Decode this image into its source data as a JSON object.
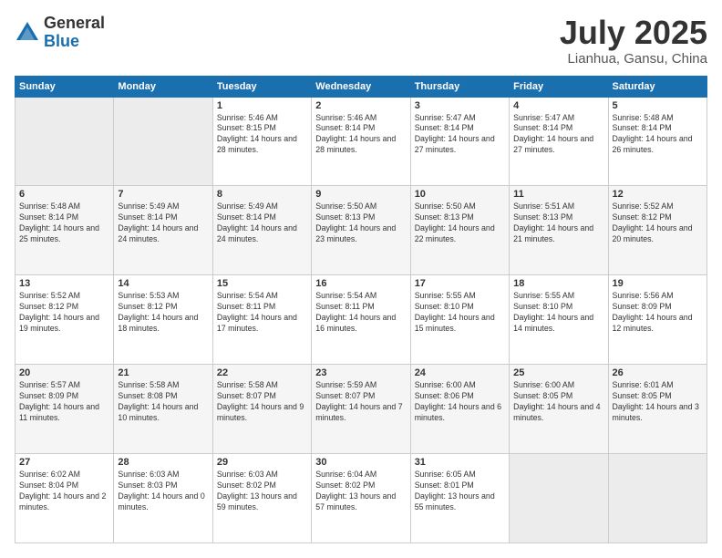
{
  "logo": {
    "general": "General",
    "blue": "Blue"
  },
  "header": {
    "month": "July 2025",
    "location": "Lianhua, Gansu, China"
  },
  "weekdays": [
    "Sunday",
    "Monday",
    "Tuesday",
    "Wednesday",
    "Thursday",
    "Friday",
    "Saturday"
  ],
  "weeks": [
    [
      {
        "day": "",
        "empty": true
      },
      {
        "day": "",
        "empty": true
      },
      {
        "day": "1",
        "sunrise": "5:46 AM",
        "sunset": "8:15 PM",
        "daylight": "14 hours and 28 minutes."
      },
      {
        "day": "2",
        "sunrise": "5:46 AM",
        "sunset": "8:14 PM",
        "daylight": "14 hours and 28 minutes."
      },
      {
        "day": "3",
        "sunrise": "5:47 AM",
        "sunset": "8:14 PM",
        "daylight": "14 hours and 27 minutes."
      },
      {
        "day": "4",
        "sunrise": "5:47 AM",
        "sunset": "8:14 PM",
        "daylight": "14 hours and 27 minutes."
      },
      {
        "day": "5",
        "sunrise": "5:48 AM",
        "sunset": "8:14 PM",
        "daylight": "14 hours and 26 minutes."
      }
    ],
    [
      {
        "day": "6",
        "sunrise": "5:48 AM",
        "sunset": "8:14 PM",
        "daylight": "14 hours and 25 minutes."
      },
      {
        "day": "7",
        "sunrise": "5:49 AM",
        "sunset": "8:14 PM",
        "daylight": "14 hours and 24 minutes."
      },
      {
        "day": "8",
        "sunrise": "5:49 AM",
        "sunset": "8:14 PM",
        "daylight": "14 hours and 24 minutes."
      },
      {
        "day": "9",
        "sunrise": "5:50 AM",
        "sunset": "8:13 PM",
        "daylight": "14 hours and 23 minutes."
      },
      {
        "day": "10",
        "sunrise": "5:50 AM",
        "sunset": "8:13 PM",
        "daylight": "14 hours and 22 minutes."
      },
      {
        "day": "11",
        "sunrise": "5:51 AM",
        "sunset": "8:13 PM",
        "daylight": "14 hours and 21 minutes."
      },
      {
        "day": "12",
        "sunrise": "5:52 AM",
        "sunset": "8:12 PM",
        "daylight": "14 hours and 20 minutes."
      }
    ],
    [
      {
        "day": "13",
        "sunrise": "5:52 AM",
        "sunset": "8:12 PM",
        "daylight": "14 hours and 19 minutes."
      },
      {
        "day": "14",
        "sunrise": "5:53 AM",
        "sunset": "8:12 PM",
        "daylight": "14 hours and 18 minutes."
      },
      {
        "day": "15",
        "sunrise": "5:54 AM",
        "sunset": "8:11 PM",
        "daylight": "14 hours and 17 minutes."
      },
      {
        "day": "16",
        "sunrise": "5:54 AM",
        "sunset": "8:11 PM",
        "daylight": "14 hours and 16 minutes."
      },
      {
        "day": "17",
        "sunrise": "5:55 AM",
        "sunset": "8:10 PM",
        "daylight": "14 hours and 15 minutes."
      },
      {
        "day": "18",
        "sunrise": "5:55 AM",
        "sunset": "8:10 PM",
        "daylight": "14 hours and 14 minutes."
      },
      {
        "day": "19",
        "sunrise": "5:56 AM",
        "sunset": "8:09 PM",
        "daylight": "14 hours and 12 minutes."
      }
    ],
    [
      {
        "day": "20",
        "sunrise": "5:57 AM",
        "sunset": "8:09 PM",
        "daylight": "14 hours and 11 minutes."
      },
      {
        "day": "21",
        "sunrise": "5:58 AM",
        "sunset": "8:08 PM",
        "daylight": "14 hours and 10 minutes."
      },
      {
        "day": "22",
        "sunrise": "5:58 AM",
        "sunset": "8:07 PM",
        "daylight": "14 hours and 9 minutes."
      },
      {
        "day": "23",
        "sunrise": "5:59 AM",
        "sunset": "8:07 PM",
        "daylight": "14 hours and 7 minutes."
      },
      {
        "day": "24",
        "sunrise": "6:00 AM",
        "sunset": "8:06 PM",
        "daylight": "14 hours and 6 minutes."
      },
      {
        "day": "25",
        "sunrise": "6:00 AM",
        "sunset": "8:05 PM",
        "daylight": "14 hours and 4 minutes."
      },
      {
        "day": "26",
        "sunrise": "6:01 AM",
        "sunset": "8:05 PM",
        "daylight": "14 hours and 3 minutes."
      }
    ],
    [
      {
        "day": "27",
        "sunrise": "6:02 AM",
        "sunset": "8:04 PM",
        "daylight": "14 hours and 2 minutes."
      },
      {
        "day": "28",
        "sunrise": "6:03 AM",
        "sunset": "8:03 PM",
        "daylight": "14 hours and 0 minutes."
      },
      {
        "day": "29",
        "sunrise": "6:03 AM",
        "sunset": "8:02 PM",
        "daylight": "13 hours and 59 minutes."
      },
      {
        "day": "30",
        "sunrise": "6:04 AM",
        "sunset": "8:02 PM",
        "daylight": "13 hours and 57 minutes."
      },
      {
        "day": "31",
        "sunrise": "6:05 AM",
        "sunset": "8:01 PM",
        "daylight": "13 hours and 55 minutes."
      },
      {
        "day": "",
        "empty": true
      },
      {
        "day": "",
        "empty": true
      }
    ]
  ]
}
